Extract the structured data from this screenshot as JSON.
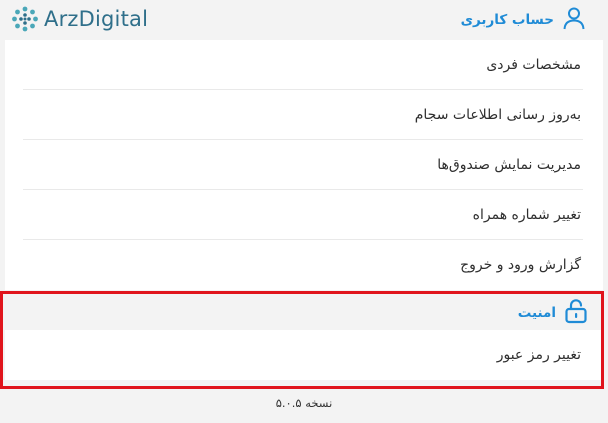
{
  "brand": {
    "name": "ArzDigital"
  },
  "account": {
    "title": "حساب کاربری",
    "items": [
      "مشخصات فردی",
      "به‌روز رسانی اطلاعات سجام",
      "مدیریت نمایش صندوق‌ها",
      "تغییر شماره همراه",
      "گزارش ورود و خروج"
    ]
  },
  "security": {
    "title": "امنیت",
    "items": [
      "تغییر رمز عبور"
    ]
  },
  "footer": {
    "version": "نسخه ۵.۰.۵"
  },
  "colors": {
    "accent": "#1f8bd6",
    "highlight_border": "#e0141c",
    "background": "#f3f3f3",
    "panel": "#ffffff"
  },
  "icons": {
    "account": "user-icon",
    "security": "unlock-icon",
    "logo": "arzdigital-logo-icon"
  }
}
